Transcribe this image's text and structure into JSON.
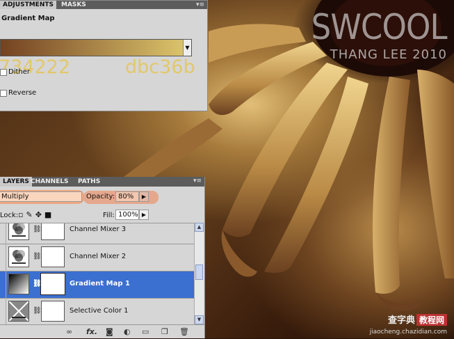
{
  "photo": {
    "watermark_title": "SWCOOL",
    "watermark_sub": "THANG LEE 2010",
    "site_name": "查字典",
    "site_box": "教程网",
    "site_url": "jiaocheng.chazidian.com"
  },
  "adjustments": {
    "tabs": [
      "ADJUSTMENTS",
      "MASKS"
    ],
    "title": "Gradient Map",
    "gradient": {
      "start_hex": "734222",
      "end_hex": "dbc36b",
      "start_color": "#734222",
      "end_color": "#dbc36b"
    },
    "dither_label": "Dither",
    "reverse_label": "Reverse"
  },
  "layers": {
    "tabs": [
      "LAYERS",
      "CHANNELS",
      "PATHS"
    ],
    "blend_mode": "Multiply",
    "opacity_label": "Opacity:",
    "opacity_value": "80%",
    "lock_label": "Lock:",
    "fill_label": "Fill:",
    "fill_value": "100%",
    "rows": [
      {
        "name": "Channel Mixer 3",
        "icon": "channel-mixer-icon",
        "selected": false
      },
      {
        "name": "Channel Mixer 2",
        "icon": "channel-mixer-icon",
        "selected": false
      },
      {
        "name": "Gradient Map 1",
        "icon": "gradient-map-icon",
        "selected": true
      },
      {
        "name": "Selective Color 1",
        "icon": "selective-color-icon",
        "selected": false
      }
    ],
    "bottom_icons": [
      "link-icon",
      "fx-icon",
      "add-mask-icon",
      "adjustment-layer-icon",
      "group-icon",
      "new-layer-icon",
      "trash-icon"
    ]
  }
}
